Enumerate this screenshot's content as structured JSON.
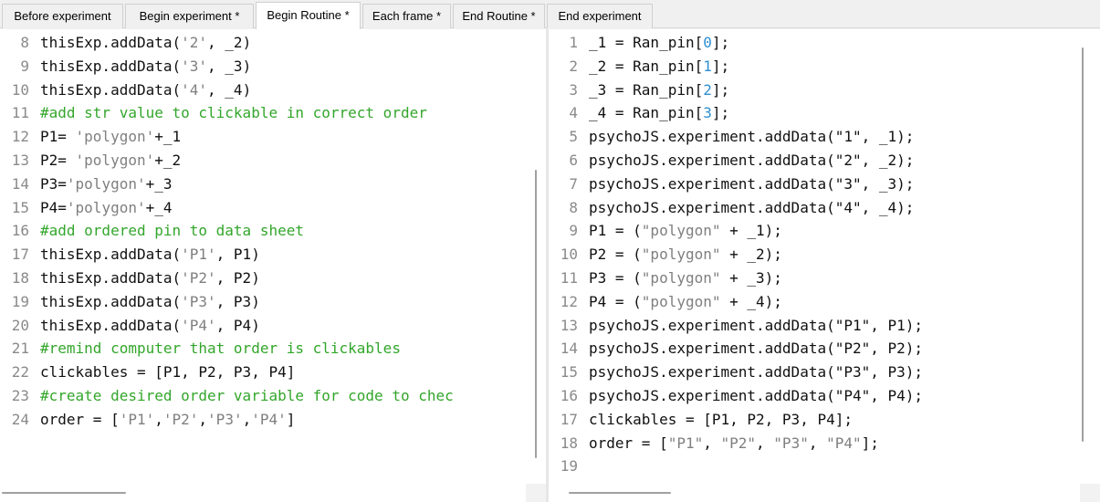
{
  "tabs": [
    {
      "label": "Before experiment",
      "active": false
    },
    {
      "label": "Begin experiment *",
      "active": false
    },
    {
      "label": "Begin Routine *",
      "active": true
    },
    {
      "label": "Each frame *",
      "active": false
    },
    {
      "label": "End Routine *",
      "active": false
    },
    {
      "label": "End experiment",
      "active": false
    }
  ],
  "left_pane": {
    "language": "Python",
    "lines": [
      {
        "n": "8",
        "tokens": [
          [
            "plain",
            "thisExp.addData("
          ],
          [
            "str",
            "'2'"
          ],
          [
            "plain",
            ", _2)"
          ]
        ]
      },
      {
        "n": "9",
        "tokens": [
          [
            "plain",
            "thisExp.addData("
          ],
          [
            "str",
            "'3'"
          ],
          [
            "plain",
            ", _3)"
          ]
        ]
      },
      {
        "n": "10",
        "tokens": [
          [
            "plain",
            "thisExp.addData("
          ],
          [
            "str",
            "'4'"
          ],
          [
            "plain",
            ", _4)"
          ]
        ]
      },
      {
        "n": "11",
        "tokens": [
          [
            "com",
            "#add str value to clickable in correct order"
          ]
        ]
      },
      {
        "n": "12",
        "tokens": [
          [
            "plain",
            "P1= "
          ],
          [
            "str",
            "'polygon'"
          ],
          [
            "plain",
            "+_1"
          ]
        ]
      },
      {
        "n": "13",
        "tokens": [
          [
            "plain",
            "P2= "
          ],
          [
            "str",
            "'polygon'"
          ],
          [
            "plain",
            "+_2"
          ]
        ]
      },
      {
        "n": "14",
        "tokens": [
          [
            "plain",
            "P3="
          ],
          [
            "str",
            "'polygon'"
          ],
          [
            "plain",
            "+_3"
          ]
        ]
      },
      {
        "n": "15",
        "tokens": [
          [
            "plain",
            "P4="
          ],
          [
            "str",
            "'polygon'"
          ],
          [
            "plain",
            "+_4"
          ]
        ]
      },
      {
        "n": "16",
        "tokens": [
          [
            "com",
            "#add ordered pin to data sheet"
          ]
        ]
      },
      {
        "n": "17",
        "tokens": [
          [
            "plain",
            "thisExp.addData("
          ],
          [
            "str",
            "'P1'"
          ],
          [
            "plain",
            ", P1)"
          ]
        ]
      },
      {
        "n": "18",
        "tokens": [
          [
            "plain",
            "thisExp.addData("
          ],
          [
            "str",
            "'P2'"
          ],
          [
            "plain",
            ", P2)"
          ]
        ]
      },
      {
        "n": "19",
        "tokens": [
          [
            "plain",
            "thisExp.addData("
          ],
          [
            "str",
            "'P3'"
          ],
          [
            "plain",
            ", P3)"
          ]
        ]
      },
      {
        "n": "20",
        "tokens": [
          [
            "plain",
            "thisExp.addData("
          ],
          [
            "str",
            "'P4'"
          ],
          [
            "plain",
            ", P4)"
          ]
        ]
      },
      {
        "n": "21",
        "tokens": [
          [
            "com",
            "#remind computer that order is clickables"
          ]
        ]
      },
      {
        "n": "22",
        "tokens": [
          [
            "plain",
            "clickables = [P1, P2, P3, P4]"
          ]
        ]
      },
      {
        "n": "23",
        "tokens": [
          [
            "com",
            "#create desired order variable for code to chec"
          ]
        ]
      },
      {
        "n": "24",
        "tokens": [
          [
            "plain",
            "order = ["
          ],
          [
            "str",
            "'P1'"
          ],
          [
            "plain",
            ","
          ],
          [
            "str",
            "'P2'"
          ],
          [
            "plain",
            ","
          ],
          [
            "str",
            "'P3'"
          ],
          [
            "plain",
            ","
          ],
          [
            "str",
            "'P4'"
          ],
          [
            "plain",
            "]"
          ]
        ]
      }
    ]
  },
  "right_pane": {
    "language": "JS",
    "lines": [
      {
        "n": "1",
        "tokens": [
          [
            "plain",
            "_1 = Ran_pin["
          ],
          [
            "num",
            "0"
          ],
          [
            "plain",
            "];"
          ]
        ]
      },
      {
        "n": "2",
        "tokens": [
          [
            "plain",
            "_2 = Ran_pin["
          ],
          [
            "num",
            "1"
          ],
          [
            "plain",
            "];"
          ]
        ]
      },
      {
        "n": "3",
        "tokens": [
          [
            "plain",
            "_3 = Ran_pin["
          ],
          [
            "num",
            "2"
          ],
          [
            "plain",
            "];"
          ]
        ]
      },
      {
        "n": "4",
        "tokens": [
          [
            "plain",
            "_4 = Ran_pin["
          ],
          [
            "num",
            "3"
          ],
          [
            "plain",
            "];"
          ]
        ]
      },
      {
        "n": "5",
        "tokens": [
          [
            "plain",
            "psychoJS.experiment.addData(\"1\", _1);"
          ]
        ]
      },
      {
        "n": "6",
        "tokens": [
          [
            "plain",
            "psychoJS.experiment.addData(\"2\", _2);"
          ]
        ]
      },
      {
        "n": "7",
        "tokens": [
          [
            "plain",
            "psychoJS.experiment.addData(\"3\", _3);"
          ]
        ]
      },
      {
        "n": "8",
        "tokens": [
          [
            "plain",
            "psychoJS.experiment.addData(\"4\", _4);"
          ]
        ]
      },
      {
        "n": "9",
        "tokens": [
          [
            "plain",
            "P1 = ("
          ],
          [
            "str",
            "\"polygon\""
          ],
          [
            "plain",
            " + _1);"
          ]
        ]
      },
      {
        "n": "10",
        "tokens": [
          [
            "plain",
            "P2 = ("
          ],
          [
            "str",
            "\"polygon\""
          ],
          [
            "plain",
            " + _2);"
          ]
        ]
      },
      {
        "n": "11",
        "tokens": [
          [
            "plain",
            "P3 = ("
          ],
          [
            "str",
            "\"polygon\""
          ],
          [
            "plain",
            " + _3);"
          ]
        ]
      },
      {
        "n": "12",
        "tokens": [
          [
            "plain",
            "P4 = ("
          ],
          [
            "str",
            "\"polygon\""
          ],
          [
            "plain",
            " + _4);"
          ]
        ]
      },
      {
        "n": "13",
        "tokens": [
          [
            "plain",
            "psychoJS.experiment.addData(\"P1\", P1);"
          ]
        ]
      },
      {
        "n": "14",
        "tokens": [
          [
            "plain",
            "psychoJS.experiment.addData(\"P2\", P2);"
          ]
        ]
      },
      {
        "n": "15",
        "tokens": [
          [
            "plain",
            "psychoJS.experiment.addData(\"P3\", P3);"
          ]
        ]
      },
      {
        "n": "16",
        "tokens": [
          [
            "plain",
            "psychoJS.experiment.addData(\"P4\", P4);"
          ]
        ]
      },
      {
        "n": "17",
        "tokens": [
          [
            "plain",
            "clickables = [P1, P2, P3, P4];"
          ]
        ]
      },
      {
        "n": "18",
        "tokens": [
          [
            "plain",
            "order = ["
          ],
          [
            "str",
            "\"P1\""
          ],
          [
            "plain",
            ", "
          ],
          [
            "str",
            "\"P2\""
          ],
          [
            "plain",
            ", "
          ],
          [
            "str",
            "\"P3\""
          ],
          [
            "plain",
            ", "
          ],
          [
            "str",
            "\"P4\""
          ],
          [
            "plain",
            "];"
          ]
        ]
      },
      {
        "n": "19",
        "tokens": []
      }
    ]
  },
  "colors": {
    "string": "#7f7f7f",
    "comment": "#33a62b",
    "number": "#2f8fd0",
    "text": "#111111"
  }
}
